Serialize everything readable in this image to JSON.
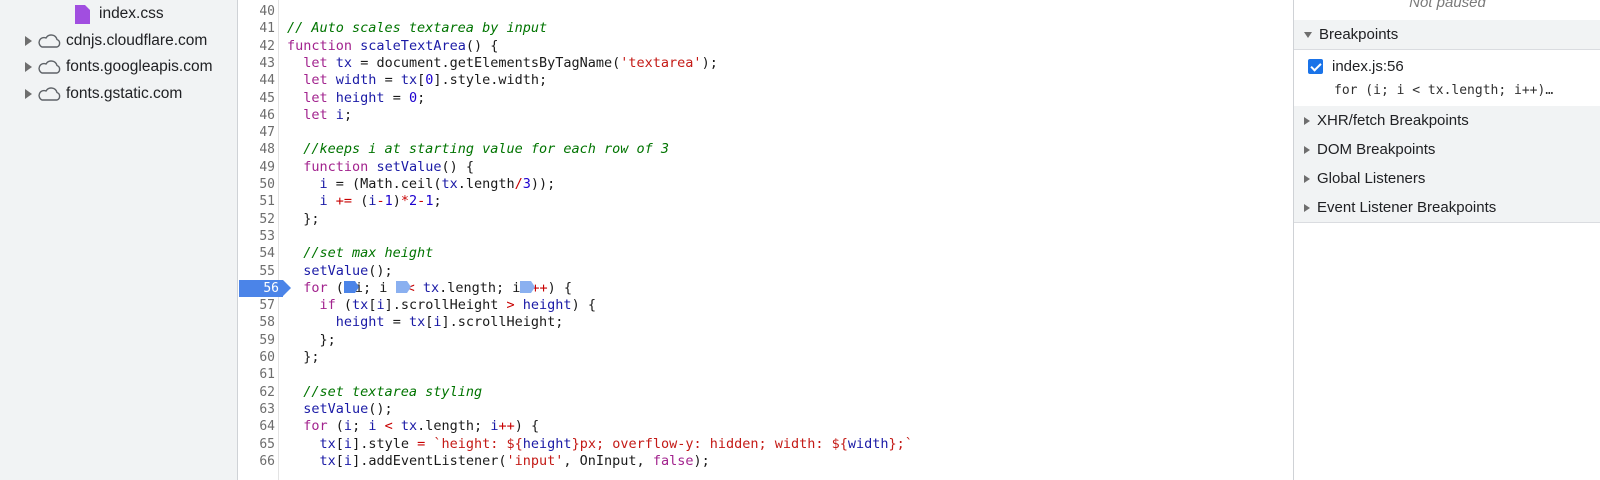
{
  "file_tree": {
    "items": [
      {
        "label": "index.css",
        "kind": "file",
        "icon": "css-file-icon"
      },
      {
        "label": "cdnjs.cloudflare.com",
        "kind": "domain",
        "icon": "cloud-icon"
      },
      {
        "label": "fonts.googleapis.com",
        "kind": "domain",
        "icon": "cloud-icon"
      },
      {
        "label": "fonts.gstatic.com",
        "kind": "domain",
        "icon": "cloud-icon"
      }
    ]
  },
  "editor": {
    "active_breakpoint_line": "56",
    "lines": [
      {
        "n": "40",
        "html": ""
      },
      {
        "n": "41",
        "html": "<span class=\"c\">// Auto scales textarea by input</span>"
      },
      {
        "n": "42",
        "html": "<span class=\"k\">function</span> <span class=\"f\">scaleTextArea</span>() {"
      },
      {
        "n": "43",
        "html": "  <span class=\"k\">let</span> <span class=\"v\">tx</span> = document.getElementsByTagName(<span class=\"s\">'textarea'</span>);"
      },
      {
        "n": "44",
        "html": "  <span class=\"k\">let</span> <span class=\"v\">width</span> = <span class=\"v\">tx</span>[<span class=\"n\">0</span>].style.width;"
      },
      {
        "n": "45",
        "html": "  <span class=\"k\">let</span> <span class=\"v\">height</span> = <span class=\"n\">0</span>;"
      },
      {
        "n": "46",
        "html": "  <span class=\"k\">let</span> <span class=\"v\">i</span>;"
      },
      {
        "n": "47",
        "html": ""
      },
      {
        "n": "48",
        "html": "  <span class=\"c\">//keeps i at starting value for each row of 3</span>"
      },
      {
        "n": "49",
        "html": "  <span class=\"k\">function</span> <span class=\"f\">setValue</span>() {"
      },
      {
        "n": "50",
        "html": "    <span class=\"v\">i</span> = (Math.ceil(<span class=\"v\">tx</span>.length<span class=\"o\">/</span><span class=\"n\">3</span>));"
      },
      {
        "n": "51",
        "html": "    <span class=\"v\">i</span> <span class=\"o\">+=</span> (<span class=\"v\">i</span><span class=\"o\">-</span><span class=\"n\">1</span>)<span class=\"o\">*</span><span class=\"n\">2</span><span class=\"o\">-</span><span class=\"n\">1</span>;"
      },
      {
        "n": "52",
        "html": "  };"
      },
      {
        "n": "53",
        "html": ""
      },
      {
        "n": "54",
        "html": "  <span class=\"c\">//set max height</span>"
      },
      {
        "n": "55",
        "html": "  <span class=\"f\">setValue</span>();"
      },
      {
        "n": "56",
        "html": "  <span class=\"k\">for</span> (<span class=\"mark active\"></span>i; i <span class=\"mark\"></span><span class=\"o\">&lt;</span> <span class=\"v\">tx</span>.length; i<span class=\"mark\"></span><span class=\"o\">++</span>) {"
      },
      {
        "n": "57",
        "html": "    <span class=\"k\">if</span> (<span class=\"v\">tx</span>[<span class=\"v\">i</span>].scrollHeight <span class=\"o\">&gt;</span> <span class=\"v\">height</span>) {"
      },
      {
        "n": "58",
        "html": "      <span class=\"v\">height</span> = <span class=\"v\">tx</span>[<span class=\"v\">i</span>].scrollHeight;"
      },
      {
        "n": "59",
        "html": "    };"
      },
      {
        "n": "60",
        "html": "  };"
      },
      {
        "n": "61",
        "html": ""
      },
      {
        "n": "62",
        "html": "  <span class=\"c\">//set textarea styling</span>"
      },
      {
        "n": "63",
        "html": "  <span class=\"f\">setValue</span>();"
      },
      {
        "n": "64",
        "html": "  <span class=\"k\">for</span> (<span class=\"v\">i</span>; <span class=\"v\">i</span> <span class=\"o\">&lt;</span> <span class=\"v\">tx</span>.length; <span class=\"v\">i</span><span class=\"o\">++</span>) {"
      },
      {
        "n": "65",
        "html": "    <span class=\"v\">tx</span>[<span class=\"v\">i</span>].style <span class=\"o\">=</span> <span class=\"s\">`height: ${</span><span class=\"v\">height</span><span class=\"s\">}px; overflow-y: hidden; width: ${</span><span class=\"v\">width</span><span class=\"s\">};`</span>"
      },
      {
        "n": "66",
        "html": "    <span class=\"v\">tx</span>[<span class=\"v\">i</span>].addEventListener(<span class=\"s\">'input'</span>, OnInput, <span class=\"k\">false</span>);"
      }
    ]
  },
  "debugger": {
    "status": "Not paused",
    "breakpoints_header": "Breakpoints",
    "breakpoint": {
      "location": "index.js:56",
      "code": "for (i; i < tx.length; i++)…",
      "checked": true
    },
    "sections": [
      "XHR/fetch Breakpoints",
      "DOM Breakpoints",
      "Global Listeners",
      "Event Listener Breakpoints"
    ]
  },
  "colors": {
    "breakpoint_blue": "#4b84e8",
    "keyword": "#a2238e",
    "string": "#c41a16",
    "comment": "#007400",
    "file_icon": "#a14ee0"
  }
}
